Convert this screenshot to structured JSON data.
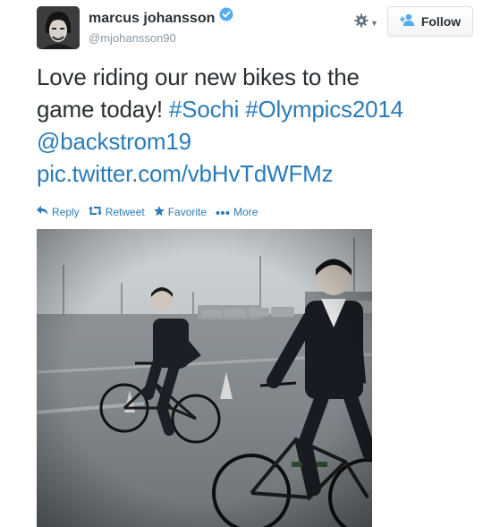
{
  "user": {
    "full_name": "marcus johansson",
    "screen_name": "@mjohansson90",
    "verified": true
  },
  "follow": {
    "label": "Follow"
  },
  "tweet": {
    "text_line1": "Love riding our new bikes to the",
    "text_line2_plain": "game today!",
    "hashtag1": "#Sochi",
    "hashtag2": "#Olympics2014",
    "mention": "@backstrom19",
    "pic_link": "pic.twitter.com/vbHvTdWFMz"
  },
  "actions": {
    "reply": "Reply",
    "retweet": "Retweet",
    "favorite": "Favorite",
    "more": "More"
  },
  "colors": {
    "link": "#2b7bb9",
    "verified": "#55acee",
    "muted": "#8899a6"
  },
  "icons": {
    "gear": "gear-icon",
    "follow_person": "add-person-icon",
    "verified": "verified-badge-icon",
    "reply": "reply-icon",
    "retweet": "retweet-icon",
    "favorite": "star-icon",
    "more": "more-dots-icon"
  }
}
